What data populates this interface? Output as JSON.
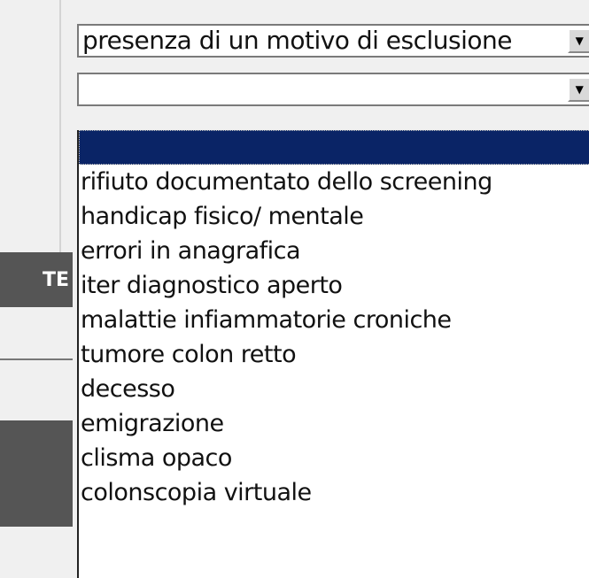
{
  "select_primary": {
    "value": "presenza di un motivo di esclusione"
  },
  "select_secondary": {
    "value": ""
  },
  "side_tab": {
    "label": "TE"
  },
  "dropdown": {
    "options": [
      {
        "label": "",
        "selected": true
      },
      {
        "label": "rifiuto documentato dello screening",
        "selected": false
      },
      {
        "label": "handicap fisico/ mentale",
        "selected": false
      },
      {
        "label": "errori in anagrafica",
        "selected": false
      },
      {
        "label": "iter diagnostico aperto",
        "selected": false
      },
      {
        "label": "malattie infiammatorie croniche",
        "selected": false
      },
      {
        "label": "tumore colon retto",
        "selected": false
      },
      {
        "label": "decesso",
        "selected": false
      },
      {
        "label": "emigrazione",
        "selected": false
      },
      {
        "label": "clisma opaco",
        "selected": false
      },
      {
        "label": "colonscopia virtuale",
        "selected": false
      }
    ]
  },
  "colors": {
    "selection": "#0a2466",
    "side_panel": "#555555"
  }
}
